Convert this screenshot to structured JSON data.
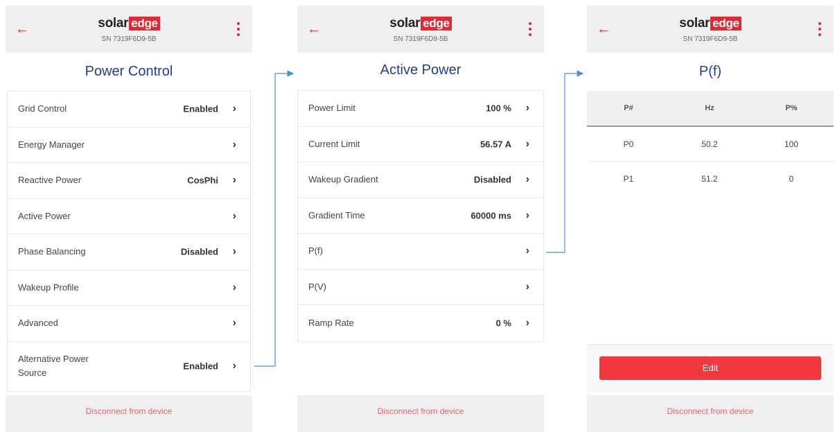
{
  "brand": {
    "solar": "solar",
    "edge": "edge",
    "serial": "SN 7319F6D9-5B"
  },
  "colors": {
    "accent": "#e8262f",
    "title": "#1f3f8f",
    "connector": "#4a8fd6"
  },
  "icons": {
    "back": "arrow-left-icon",
    "menu": "kebab-menu-icon",
    "chevron": "chevron-right-icon"
  },
  "screen1": {
    "title": "Power Control",
    "items": [
      {
        "label": "Grid Control",
        "value": "Enabled"
      },
      {
        "label": "Energy Manager",
        "value": ""
      },
      {
        "label": "Reactive Power",
        "value": "CosPhi"
      },
      {
        "label": "Active Power",
        "value": ""
      },
      {
        "label": "Phase Balancing",
        "value": "Disabled"
      },
      {
        "label": "Wakeup Profile",
        "value": ""
      },
      {
        "label": "Advanced",
        "value": ""
      },
      {
        "label": "Alternative Power Source",
        "value": "Enabled"
      }
    ],
    "disconnect": "Disconnect from device"
  },
  "screen2": {
    "title": "Active Power",
    "items": [
      {
        "label": "Power Limit",
        "value": "100 %"
      },
      {
        "label": "Current Limit",
        "value": "56.57 A"
      },
      {
        "label": "Wakeup Gradient",
        "value": "Disabled"
      },
      {
        "label": "Gradient Time",
        "value": "60000 ms"
      },
      {
        "label": "P(f)",
        "value": ""
      },
      {
        "label": "P(V)",
        "value": ""
      },
      {
        "label": "Ramp Rate",
        "value": "0 %"
      }
    ],
    "disconnect": "Disconnect from device"
  },
  "screen3": {
    "title": "P(f)",
    "columns": [
      "P#",
      "Hz",
      "P%"
    ],
    "rows": [
      [
        "P0",
        "50.2",
        "100"
      ],
      [
        "P1",
        "51.2",
        "0"
      ]
    ],
    "edit": "Edit",
    "disconnect": "Disconnect from device"
  }
}
